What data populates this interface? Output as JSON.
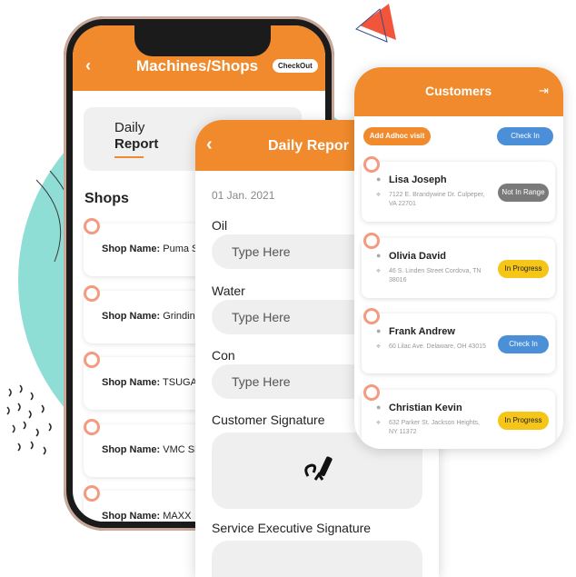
{
  "colors": {
    "accent": "#f08a2c",
    "not_in_range": "#7a7a7a",
    "in_progress": "#f5c518",
    "check_in": "#4b8fd9"
  },
  "machines_screen": {
    "title": "Machines/Shops",
    "back_icon": "chevron-left-icon",
    "checkout_label": "CheckOut",
    "tabs": {
      "daily": "Daily",
      "report": "Report"
    },
    "shops_heading": "Shops",
    "shop_prefix": "Shop Name:",
    "shops": [
      "Puma Sh",
      "Grinding",
      "TSUGAM",
      "VMC Sho",
      "MAXX"
    ]
  },
  "daily_report": {
    "title": "Daily Repor",
    "back_icon": "chevron-left-icon",
    "date": "01 Jan. 2021",
    "fields": [
      {
        "label": "Oil",
        "placeholder": "Type Here"
      },
      {
        "label": "Water",
        "placeholder": "Type Here"
      },
      {
        "label": "Con",
        "placeholder": "Type Here"
      }
    ],
    "customer_signature": "Customer Signature",
    "service_signature": "Service Executive Signature"
  },
  "customers": {
    "title": "Customers",
    "logout_icon": "logout-icon",
    "add_adhoc": "Add Adhoc visit",
    "check_in": "Check In",
    "list": [
      {
        "name": "Lisa Joseph",
        "address": "7122 E. Brandywine Dr. Culpeper, VA 22701",
        "status": "Not In Range"
      },
      {
        "name": "Olivia David",
        "address": "46 S. Linden Street Cordova, TN 38016",
        "status": "In Progress"
      },
      {
        "name": "Frank Andrew",
        "address": "60 Lilac Ave. Delaware, OH 43015",
        "status": "Check In"
      },
      {
        "name": "Christian Kevin",
        "address": "632 Parker St. Jackson Heights, NY 11372",
        "status": "In Progress"
      }
    ]
  }
}
